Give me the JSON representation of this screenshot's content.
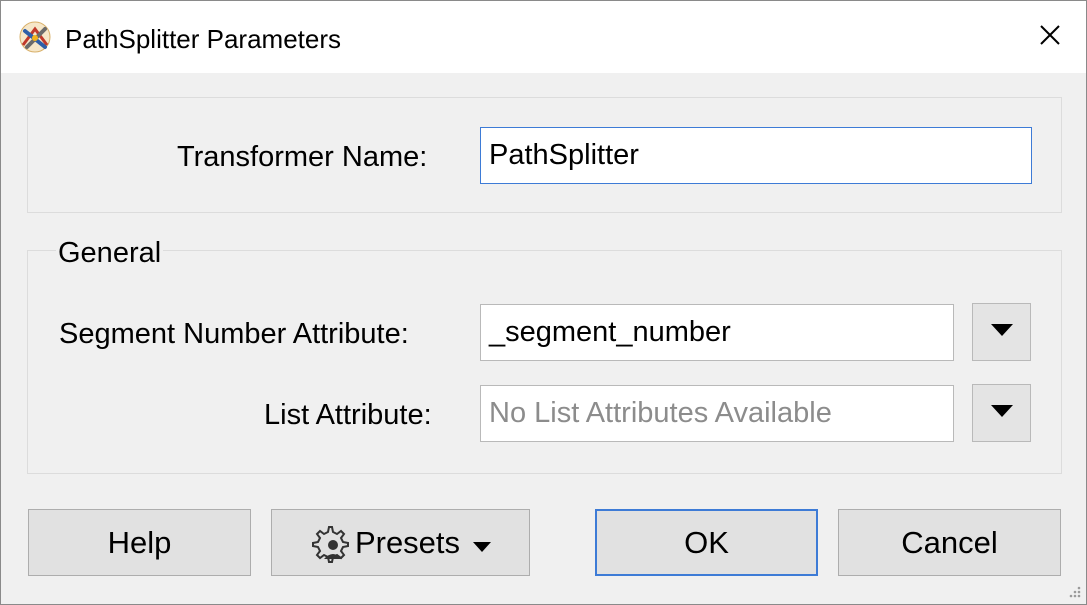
{
  "window": {
    "title": "PathSplitter Parameters",
    "app_icon": "fme-transformer-icon",
    "close_icon": "close-icon"
  },
  "transformer": {
    "name_label": "Transformer Name:",
    "name_value": "PathSplitter"
  },
  "general": {
    "group_title": "General",
    "segment_label": "Segment Number Attribute:",
    "segment_value": "_segment_number",
    "list_label": "List Attribute:",
    "list_placeholder": "No List Attributes Available"
  },
  "buttons": {
    "help": "Help",
    "presets": "Presets",
    "ok": "OK",
    "cancel": "Cancel"
  },
  "colors": {
    "focus_border": "#3d7bd6",
    "dialog_bg": "#f0f0f0"
  }
}
